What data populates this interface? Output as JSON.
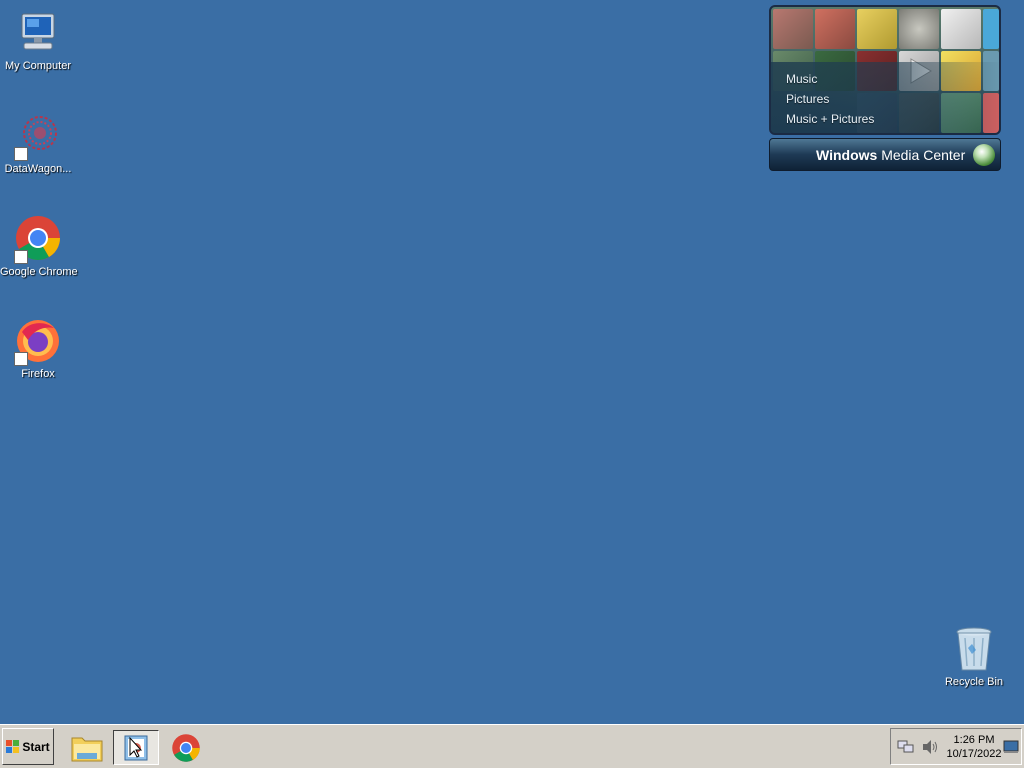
{
  "desktop": {
    "icons": [
      {
        "label": "My Computer",
        "icon": "computer-icon"
      },
      {
        "label": "DataWagon...",
        "icon": "datawagon-icon"
      },
      {
        "label": "Google Chrome",
        "icon": "chrome-icon"
      },
      {
        "label": "Firefox",
        "icon": "firefox-icon"
      },
      {
        "label": "Recycle Bin",
        "icon": "recycle-bin-icon"
      }
    ]
  },
  "media_center": {
    "menu": [
      "Music",
      "Pictures",
      "Music + Pictures"
    ],
    "title_bold": "Windows",
    "title_rest": " Media Center"
  },
  "taskbar": {
    "start_label": "Start",
    "apps": [
      {
        "icon": "file-explorer-icon",
        "active": false
      },
      {
        "icon": "image-viewer-icon",
        "active": true
      },
      {
        "icon": "chrome-icon",
        "active": false
      }
    ],
    "clock": {
      "time": "1:26 PM",
      "date": "10/17/2022"
    }
  },
  "colors": {
    "desktop_background": "#3a6ea5",
    "taskbar": "#d4d0c8"
  }
}
